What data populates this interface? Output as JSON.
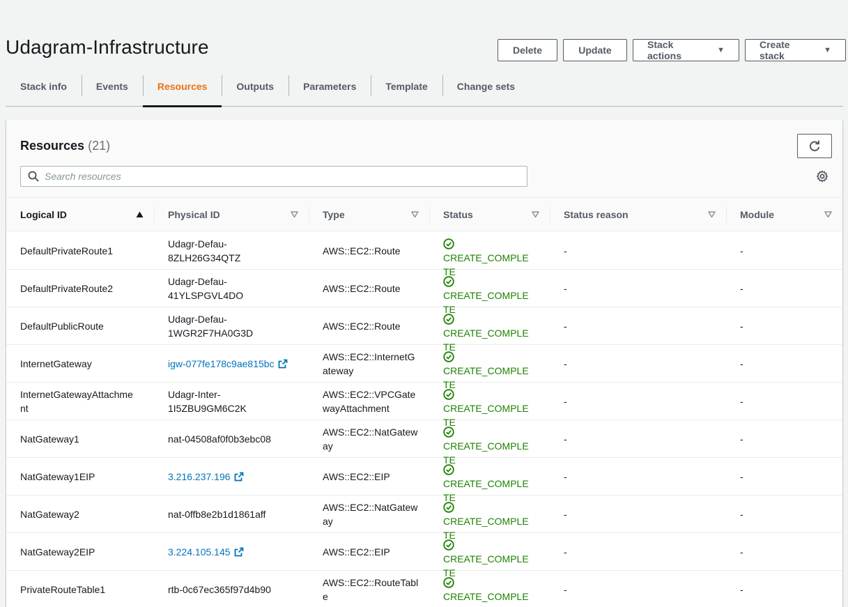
{
  "stack": {
    "title": "Udagram-Infrastructure"
  },
  "actions": {
    "delete": "Delete",
    "update": "Update",
    "stack_actions": "Stack actions",
    "create_stack": "Create stack"
  },
  "tabs": [
    {
      "label": "Stack info"
    },
    {
      "label": "Events"
    },
    {
      "label": "Resources",
      "active": true
    },
    {
      "label": "Outputs"
    },
    {
      "label": "Parameters"
    },
    {
      "label": "Template"
    },
    {
      "label": "Change sets"
    }
  ],
  "resources": {
    "title": "Resources",
    "count": "(21)",
    "search_placeholder": "Search resources",
    "columns": [
      "Logical ID",
      "Physical ID",
      "Type",
      "Status",
      "Status reason",
      "Module"
    ],
    "rows": [
      {
        "logical_id": "DefaultPrivateRoute1",
        "physical_id": [
          "Udagr-Defau-",
          "8ZLH26G34QTZ"
        ],
        "physical_link": false,
        "type": [
          "AWS::EC2::Route"
        ],
        "status": [
          "CREATE_COMPLE",
          "TE"
        ],
        "status_reason": "-",
        "module": "-"
      },
      {
        "logical_id": "DefaultPrivateRoute2",
        "physical_id": [
          "Udagr-Defau-",
          "41YLSPGVL4DO"
        ],
        "physical_link": false,
        "type": [
          "AWS::EC2::Route"
        ],
        "status": [
          "CREATE_COMPLE",
          "TE"
        ],
        "status_reason": "-",
        "module": "-"
      },
      {
        "logical_id": "DefaultPublicRoute",
        "physical_id": [
          "Udagr-Defau-",
          "1WGR2F7HA0G3D"
        ],
        "physical_link": false,
        "type": [
          "AWS::EC2::Route"
        ],
        "status": [
          "CREATE_COMPLE",
          "TE"
        ],
        "status_reason": "-",
        "module": "-"
      },
      {
        "logical_id": "InternetGateway",
        "physical_id": [
          "igw-077fe178c9ae815bc"
        ],
        "physical_link": true,
        "type": [
          "AWS::EC2::InternetG",
          "ateway"
        ],
        "status": [
          "CREATE_COMPLE",
          "TE"
        ],
        "status_reason": "-",
        "module": "-"
      },
      {
        "logical_id": "InternetGatewayAttachme\nnt",
        "physical_id": [
          "Udagr-Inter-",
          "1I5ZBU9GM6C2K"
        ],
        "physical_link": false,
        "type": [
          "AWS::EC2::VPCGate",
          "wayAttachment"
        ],
        "status": [
          "CREATE_COMPLE",
          "TE"
        ],
        "status_reason": "-",
        "module": "-"
      },
      {
        "logical_id": "NatGateway1",
        "physical_id": [
          "nat-04508af0f0b3ebc08"
        ],
        "physical_link": false,
        "type": [
          "AWS::EC2::NatGatew",
          "ay"
        ],
        "status": [
          "CREATE_COMPLE",
          "TE"
        ],
        "status_reason": "-",
        "module": "-"
      },
      {
        "logical_id": "NatGateway1EIP",
        "physical_id": [
          "3.216.237.196"
        ],
        "physical_link": true,
        "type": [
          "AWS::EC2::EIP"
        ],
        "status": [
          "CREATE_COMPLE",
          "TE"
        ],
        "status_reason": "-",
        "module": "-"
      },
      {
        "logical_id": "NatGateway2",
        "physical_id": [
          "nat-0ffb8e2b1d1861aff"
        ],
        "physical_link": false,
        "type": [
          "AWS::EC2::NatGatew",
          "ay"
        ],
        "status": [
          "CREATE_COMPLE",
          "TE"
        ],
        "status_reason": "-",
        "module": "-"
      },
      {
        "logical_id": "NatGateway2EIP",
        "physical_id": [
          "3.224.105.145"
        ],
        "physical_link": true,
        "type": [
          "AWS::EC2::EIP"
        ],
        "status": [
          "CREATE_COMPLE",
          "TE"
        ],
        "status_reason": "-",
        "module": "-"
      },
      {
        "logical_id": "PrivateRouteTable1",
        "physical_id": [
          "rtb-0c67ec365f97d4b90"
        ],
        "physical_link": false,
        "type": [
          "AWS::EC2::RouteTabl",
          "e"
        ],
        "status": [
          "CREATE_COMPLE",
          "TE"
        ],
        "status_reason": "-",
        "module": "-"
      }
    ]
  },
  "colors": {
    "accent": "#ec7211",
    "link": "#0073bb",
    "success": "#1d8102"
  }
}
